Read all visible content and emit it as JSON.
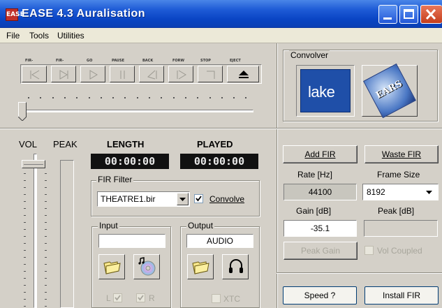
{
  "window": {
    "title": "EASE 4.3  Auralisation",
    "app_icon": "EASE"
  },
  "menu": [
    "File",
    "Tools",
    "Utilities"
  ],
  "transport": {
    "labels": [
      "FIR-",
      "FIR-",
      "GO",
      "PAUSE",
      "BACK",
      "FORW",
      "STOP",
      "EJECT"
    ],
    "icons": [
      "skip-start-icon",
      "skip-end-icon",
      "play-icon",
      "pause-icon",
      "rewind-icon",
      "forward-icon",
      "stop-icon",
      "eject-icon"
    ]
  },
  "convolver": {
    "title": "Convolver",
    "lake_label": "lake",
    "ears_label": "EARS"
  },
  "meters": {
    "vol_label": "VOL",
    "peak_label": "PEAK",
    "length_label": "LENGTH",
    "played_label": "PLAYED",
    "length_value": "00:00:00",
    "played_value": "00:00:00"
  },
  "fir_filter": {
    "title": "FIR Filter",
    "selected": "THEATRE1.bir",
    "convolve_label": "Convolve",
    "convolve_checked": true
  },
  "input": {
    "title": "Input",
    "value": "",
    "l_label": "L",
    "r_label": "R"
  },
  "output": {
    "title": "Output",
    "value": "AUDIO",
    "xtc_label": "XTC"
  },
  "right_panel": {
    "add_fir": "Add FIR",
    "waste_fir": "Waste FIR",
    "rate_label": "Rate [Hz]",
    "frame_size_label": "Frame Size",
    "rate_value": "44100",
    "frame_size_value": "8192",
    "gain_label": "Gain [dB]",
    "peak_label": "Peak [dB]",
    "gain_value": "-35.1",
    "peak_value": "",
    "peak_gain": "Peak Gain",
    "vol_coupled": "Vol Coupled",
    "speed": "Speed ?",
    "install_fir": "Install FIR"
  },
  "colors": {
    "title_bar": "#0a45c4",
    "face": "#d4d0c8",
    "lcd": "#111111",
    "lake_blue": "#1f4fa8"
  }
}
